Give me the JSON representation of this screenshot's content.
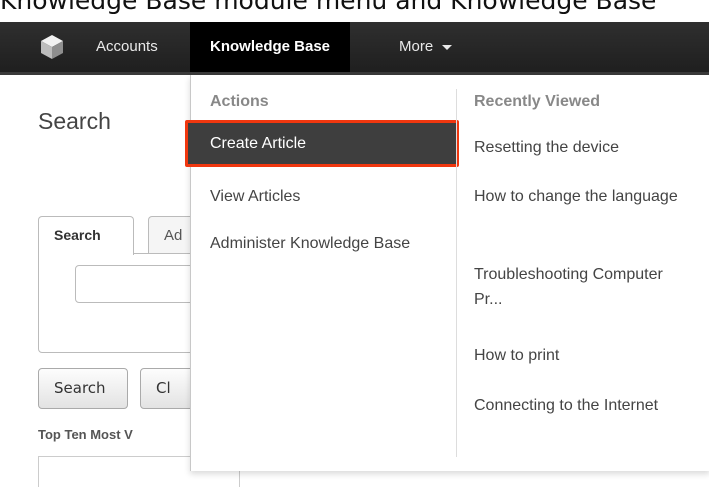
{
  "top_strip_text": "Knowledge Base module menu and Knowledge Base",
  "nav": {
    "accounts_label": "Accounts",
    "knowledge_base_label": "Knowledge Base",
    "more_label": "More"
  },
  "page": {
    "title": "Search",
    "tabs": [
      "Search",
      "Ad"
    ],
    "buttons": {
      "search_label": "Search",
      "clear_label": "Cl"
    },
    "top_ten_label": "Top Ten Most V"
  },
  "dropdown": {
    "actions_header": "Actions",
    "actions": [
      {
        "label": "Create Article",
        "highlighted": true
      },
      {
        "label": "View Articles"
      },
      {
        "label": "Administer Knowledge Base"
      }
    ],
    "recent_header": "Recently Viewed",
    "recent": [
      {
        "label": "Resetting the device"
      },
      {
        "label": "How to change the language"
      },
      {
        "label": "Troubleshooting Computer Pr..."
      },
      {
        "label": "How to print"
      },
      {
        "label": "Connecting to the Internet"
      }
    ]
  },
  "colors": {
    "navbar": "#252525",
    "active_nav": "#000000",
    "highlight_border": "#f0370f",
    "highlight_fill": "#3e3e3e"
  },
  "icons": {
    "logo": "cube-logo-icon",
    "more_caret": "caret-down-icon"
  }
}
